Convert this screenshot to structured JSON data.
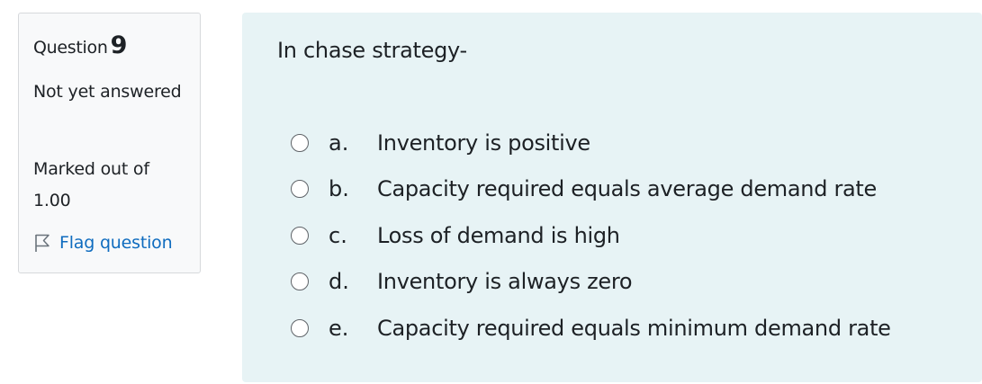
{
  "info": {
    "question_label": "Question",
    "question_number": "9",
    "state": "Not yet answered",
    "grade": "Marked out of 1.00",
    "flag_label": "Flag question",
    "flag_icon": "flag-icon"
  },
  "question": {
    "text": "In chase strategy-",
    "options": [
      {
        "letter": "a.",
        "text": "Inventory is positive",
        "selected": false
      },
      {
        "letter": "b.",
        "text": "Capacity required equals average demand rate",
        "selected": false
      },
      {
        "letter": "c.",
        "text": "Loss of demand is high",
        "selected": false
      },
      {
        "letter": "d.",
        "text": "Inventory is always zero",
        "selected": false
      },
      {
        "letter": "e.",
        "text": "Capacity required equals minimum demand rate",
        "selected": false
      }
    ]
  },
  "colors": {
    "info_background": "#f8f9fa",
    "info_border": "#d6d9dc",
    "content_background": "#e7f3f5",
    "link": "#0f6cbf",
    "text": "#1d2125"
  }
}
